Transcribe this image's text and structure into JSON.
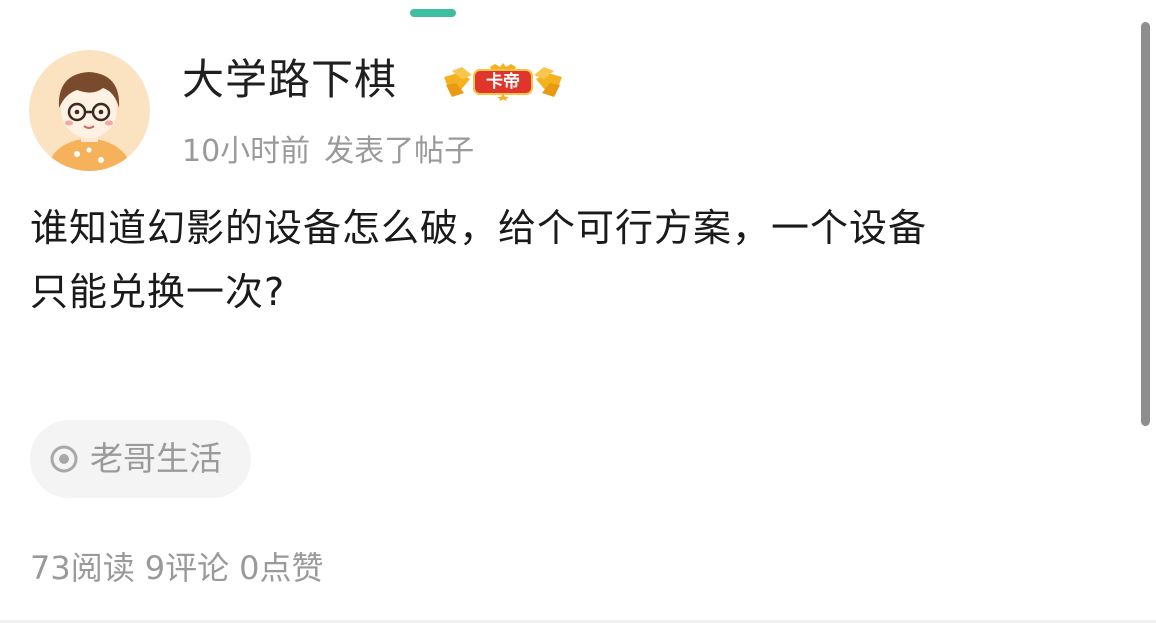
{
  "post": {
    "author": {
      "name": "大学路下棋",
      "badge_label": "卡帝",
      "avatar_icon": "cartoon-boy-avatar"
    },
    "time_ago": "10小时前",
    "action": "发表了帖子",
    "content": "谁知道幻影的设备怎么破，给个可行方案，一个设备\n只能兑换一次?",
    "topic": {
      "icon": "topic-circle-icon",
      "label": "老哥生活"
    },
    "stats": {
      "reads": "73阅读",
      "comments": "9评论",
      "likes": "0点赞"
    }
  },
  "colors": {
    "accent_handle": "#3fbf9f",
    "badge_red": "#e0352b",
    "badge_gold": "#f5b21f",
    "muted_text": "#9a9a9a",
    "body_text": "#1a1a1a"
  }
}
